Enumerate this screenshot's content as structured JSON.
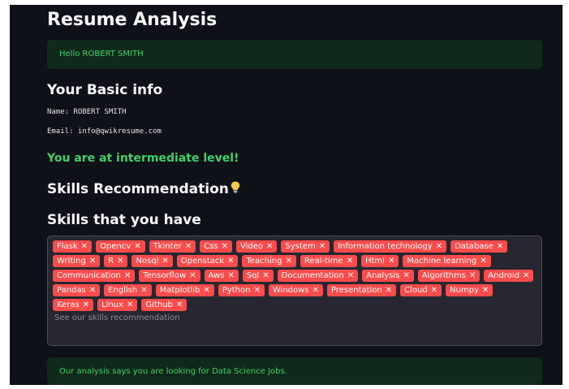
{
  "page_title": "Resume Analysis",
  "greeting": "Hello ROBERT SMITH",
  "basic_info": {
    "heading": "Your Basic info",
    "name_line": "Name: ROBERT SMITH",
    "email_line": "Email: info@qwikresume.com"
  },
  "level_message": "You are at intermediate level!",
  "skills_recommendation_heading": "Skills Recommendation",
  "skills_have_heading": "Skills that you have",
  "skills": [
    "Flask",
    "Opencv",
    "Tkinter",
    "Css",
    "Video",
    "System",
    "Information technology",
    "Database",
    "Writing",
    "R",
    "Nosql",
    "Openstack",
    "Teaching",
    "Real-time",
    "Html",
    "Machine learning",
    "Communication",
    "Tensorflow",
    "Aws",
    "Sql",
    "Documentation",
    "Analysis",
    "Algorithms",
    "Android",
    "Pandas",
    "English",
    "Matplotlib",
    "Python",
    "Windows",
    "Presentation",
    "Cloud",
    "Numpy",
    "Keras",
    "Linux",
    "Github"
  ],
  "skills_placeholder": "See our skills recommendation",
  "analysis_message": "Our analysis says you are looking for Data Science Jobs.",
  "icons": {
    "recommendation": "lightbulb-icon",
    "tag_remove": "close-icon"
  },
  "colors": {
    "background": "#0e1117",
    "success_text": "#3fd06a",
    "tag": "#ff4b4b"
  }
}
